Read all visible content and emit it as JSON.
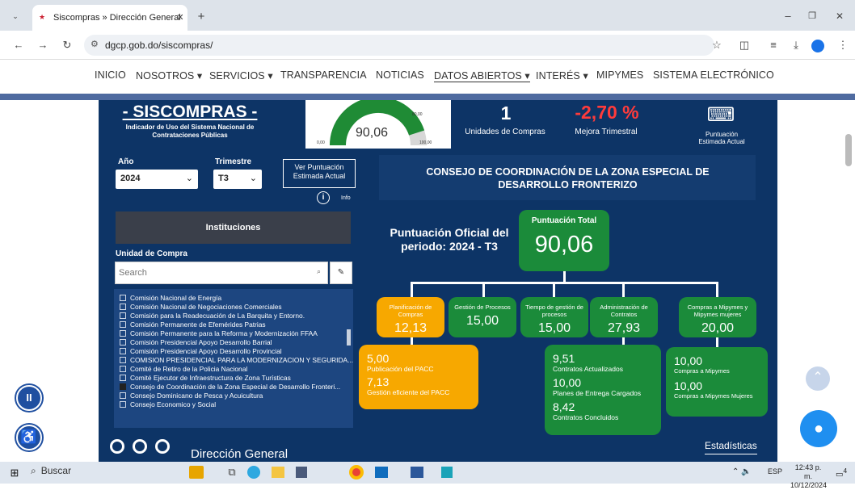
{
  "browser": {
    "tab_title": "Siscompras » Dirección General",
    "url": "dgcp.gob.do/siscompras/"
  },
  "nav": [
    "INICIO",
    "NOSOTROS ▾",
    "SERVICIOS ▾",
    "TRANSPARENCIA",
    "NOTICIAS",
    "DATOS ABIERTOS ▾",
    "INTERÉS ▾",
    "MIPYMES",
    "SISTEMA ELECTRÓNICO"
  ],
  "header": {
    "title": "- SISCOMPRAS -",
    "subtitle": "Indicador de Uso del Sistema Nacional de Contrataciones Públicas",
    "gauge": {
      "value": "90,06",
      "min": "0,00",
      "max": "100,00",
      "target": "80,00"
    },
    "units_value": "1",
    "units_label": "Unidades de Compras",
    "mejora_value": "-2,70 %",
    "mejora_label": "Mejora Trimestral",
    "puntuacion_estimada_label": "Puntuación Estimada Actual"
  },
  "filters": {
    "year_label": "Año",
    "year_value": "2024",
    "quarter_label": "Trimestre",
    "quarter_value": "T3",
    "ver_button": "Ver Puntuación Estimada Actual",
    "info_label": "Info"
  },
  "institutions": {
    "button": "Instituciones",
    "unit_label": "Unidad de Compra",
    "search_placeholder": "Search",
    "items": [
      {
        "label": "Comisión Nacional de Energía",
        "checked": false
      },
      {
        "label": "Comisión Nacional de Negociaciones Comerciales",
        "checked": false
      },
      {
        "label": "Comisión para la Readecuación de La Barquita y Entorno.",
        "checked": false
      },
      {
        "label": "Comisión Permanente de Efemérides Patrias",
        "checked": false
      },
      {
        "label": "Comisión Permanente para la Reforma y Modernización FFAA",
        "checked": false
      },
      {
        "label": "Comisión Presidencial Apoyo Desarrollo Barrial",
        "checked": false
      },
      {
        "label": "Comisión Presidencial Apoyo Desarrollo Provincial",
        "checked": false
      },
      {
        "label": "COMISION PRESIDENCIAL PARA LA MODERNIZACION Y SEGURIDA...",
        "checked": false
      },
      {
        "label": "Comité de Retiro de la Policia Nacional",
        "checked": false
      },
      {
        "label": "Comité Ejecutor de Infraestructura de Zona Turísticas",
        "checked": false
      },
      {
        "label": "Consejo de Coordinación de la Zona Especial de Desarrollo Fronteri...",
        "checked": true
      },
      {
        "label": "Consejo Dominicano de Pesca y Acuicultura",
        "checked": false
      },
      {
        "label": "Consejo Economico y Social",
        "checked": false
      }
    ]
  },
  "entity_title": "CONSEJO DE COORDINACIÓN DE LA ZONA ESPECIAL DE DESARROLLO FRONTERIZO",
  "oficial_label": "Puntuación Oficial del periodo: 2024 - T3",
  "total": {
    "label": "Puntuación Total",
    "value": "90,06"
  },
  "boxes": [
    {
      "label": "Planificación de Compras",
      "value": "12,13",
      "color": "#f7a800"
    },
    {
      "label": "Gestión de Procesos",
      "value": "15,00",
      "color": "#1b8b3a"
    },
    {
      "label": "Tiempo de gestión de procesos",
      "value": "15,00",
      "color": "#1b8b3a"
    },
    {
      "label": "Administración de Contratos",
      "value": "27,93",
      "color": "#1b8b3a"
    },
    {
      "label": "Compras a Mipymes y Mipymes mujeres",
      "value": "20,00",
      "color": "#1b8b3a"
    }
  ],
  "details": {
    "planificacion": [
      {
        "value": "5,00",
        "label": "Publicación del PACC"
      },
      {
        "value": "7,13",
        "label": "Gestión eficiente del PACC"
      }
    ],
    "contratos": [
      {
        "value": "9,51",
        "label": "Contratos Actualizados"
      },
      {
        "value": "10,00",
        "label": "Planes de Entrega Cargados"
      },
      {
        "value": "8,42",
        "label": "Contratos Concluidos"
      }
    ],
    "mipymes": [
      {
        "value": "10,00",
        "label": "Compras a Mipymes"
      },
      {
        "value": "10,00",
        "label": "Compras a Mipymes Mujeres"
      }
    ]
  },
  "footer": {
    "logo_text": "Dirección General",
    "estadisticas": "Estadísticas"
  },
  "taskbar": {
    "search": "Buscar",
    "lang": "ESP",
    "time": "12:43 p. m.",
    "date": "10/12/2024",
    "notif": "4"
  }
}
